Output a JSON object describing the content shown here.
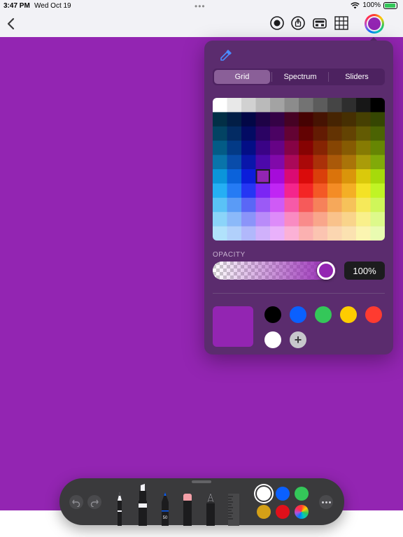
{
  "status_bar": {
    "time": "3:47 PM",
    "date": "Wed Oct 19",
    "battery": "100%",
    "icons": [
      "wifi-icon",
      "battery-charging-icon"
    ]
  },
  "toolbar": {
    "icons": [
      "back-chevron-icon",
      "record-icon",
      "share-icon",
      "toolbox-icon",
      "grid-icon",
      "color-well-icon"
    ],
    "current_color": "#9325b2"
  },
  "color_picker": {
    "eyedropper_icon": "eyedropper-icon",
    "tabs": [
      {
        "label": "Grid",
        "active": true
      },
      {
        "label": "Spectrum",
        "active": false
      },
      {
        "label": "Sliders",
        "active": false
      }
    ],
    "selected_grid_cell": {
      "row": 5,
      "col": 3
    },
    "opacity": {
      "label": "OPACITY",
      "value": "100%",
      "fraction": 1.0
    },
    "current_color": "#9325b2",
    "saved_colors": [
      "#000000",
      "#0a60ff",
      "#34c759",
      "#ffcc00",
      "#ff3b30",
      "#ffffff"
    ],
    "add_icon": "plus-icon"
  },
  "tool_palette": {
    "icons": [
      "undo-icon",
      "redo-icon",
      "pen-icon",
      "marker-icon",
      "pencil-icon",
      "eraser-icon",
      "lasso-icon",
      "ruler-icon",
      "more-icon"
    ],
    "pencil_width_label": "50",
    "swatches": [
      {
        "color": "#ffffff",
        "selected": true
      },
      {
        "color": "#0a60ff",
        "selected": false
      },
      {
        "color": "#34c759",
        "selected": false
      },
      {
        "color": "#d4a017",
        "selected": false
      },
      {
        "color": "#e0101a",
        "selected": false
      },
      {
        "color": "color-wheel",
        "selected": false
      }
    ]
  },
  "canvas": {
    "color": "#9325b2"
  }
}
